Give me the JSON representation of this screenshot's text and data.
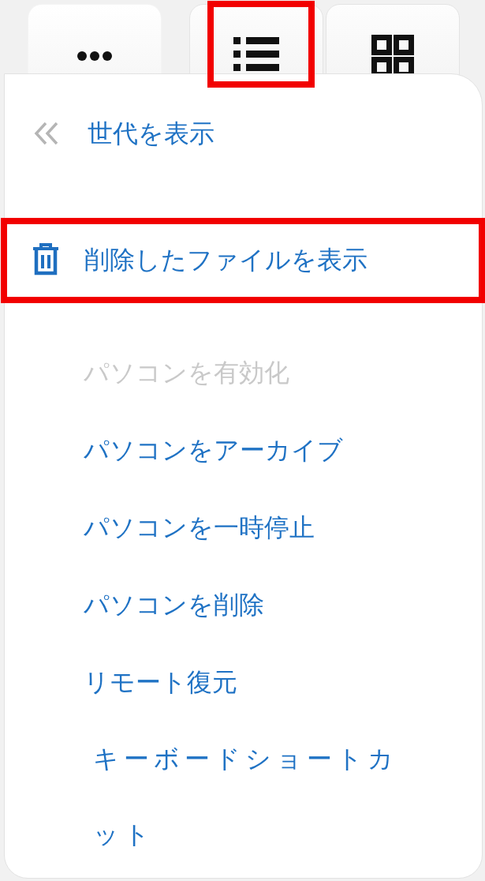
{
  "toolbar": [
    {
      "kind": "more",
      "highlighted": false
    },
    {
      "kind": "list",
      "highlighted": true
    },
    {
      "kind": "grid",
      "highlighted": false
    }
  ],
  "menu": {
    "groups": [
      [
        {
          "kind": "back",
          "label": "世代を表示",
          "disabled": false,
          "highlighted": false
        }
      ],
      [
        {
          "kind": "trash",
          "label": "削除したファイルを表示",
          "disabled": false,
          "highlighted": true
        }
      ],
      [
        {
          "kind": "action",
          "label": "パソコンを有効化",
          "disabled": true,
          "highlighted": false
        },
        {
          "kind": "action",
          "label": "パソコンをアーカイブ",
          "disabled": false,
          "highlighted": false
        },
        {
          "kind": "action",
          "label": "パソコンを一時停止",
          "disabled": false,
          "highlighted": false
        },
        {
          "kind": "action",
          "label": "パソコンを削除",
          "disabled": false,
          "highlighted": false
        },
        {
          "kind": "action",
          "label": "リモート復元",
          "disabled": false,
          "highlighted": false
        },
        {
          "kind": "action",
          "label": "キーボードショートカット",
          "disabled": false,
          "highlighted": false
        }
      ]
    ]
  }
}
